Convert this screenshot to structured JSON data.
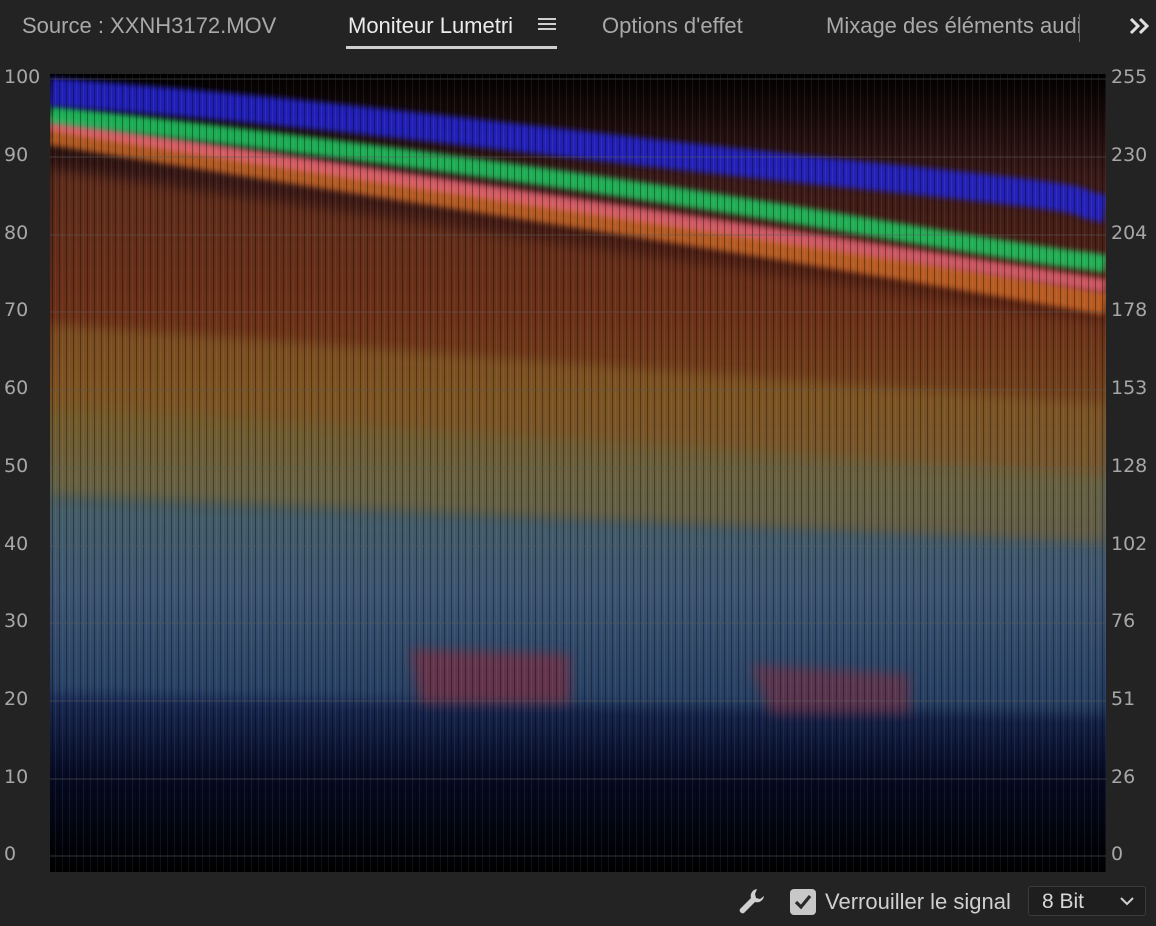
{
  "tabs": {
    "source": "Source : XXNH3172.MOV",
    "lumetri": "Moniteur Lumetri",
    "options": "Options d'effet",
    "mixage": "Mixage des éléments audio"
  },
  "scope": {
    "type": "waveform-rgb",
    "left_axis": [
      "100",
      "90",
      "80",
      "70",
      "60",
      "50",
      "40",
      "30",
      "20",
      "10",
      "0"
    ],
    "right_axis": [
      "255",
      "230",
      "204",
      "178",
      "153",
      "128",
      "102",
      "76",
      "51",
      "26",
      "0"
    ]
  },
  "bottom": {
    "lock_label": "Verrouiller le signal",
    "lock_checked": true,
    "bitdepth": "8 Bit"
  }
}
